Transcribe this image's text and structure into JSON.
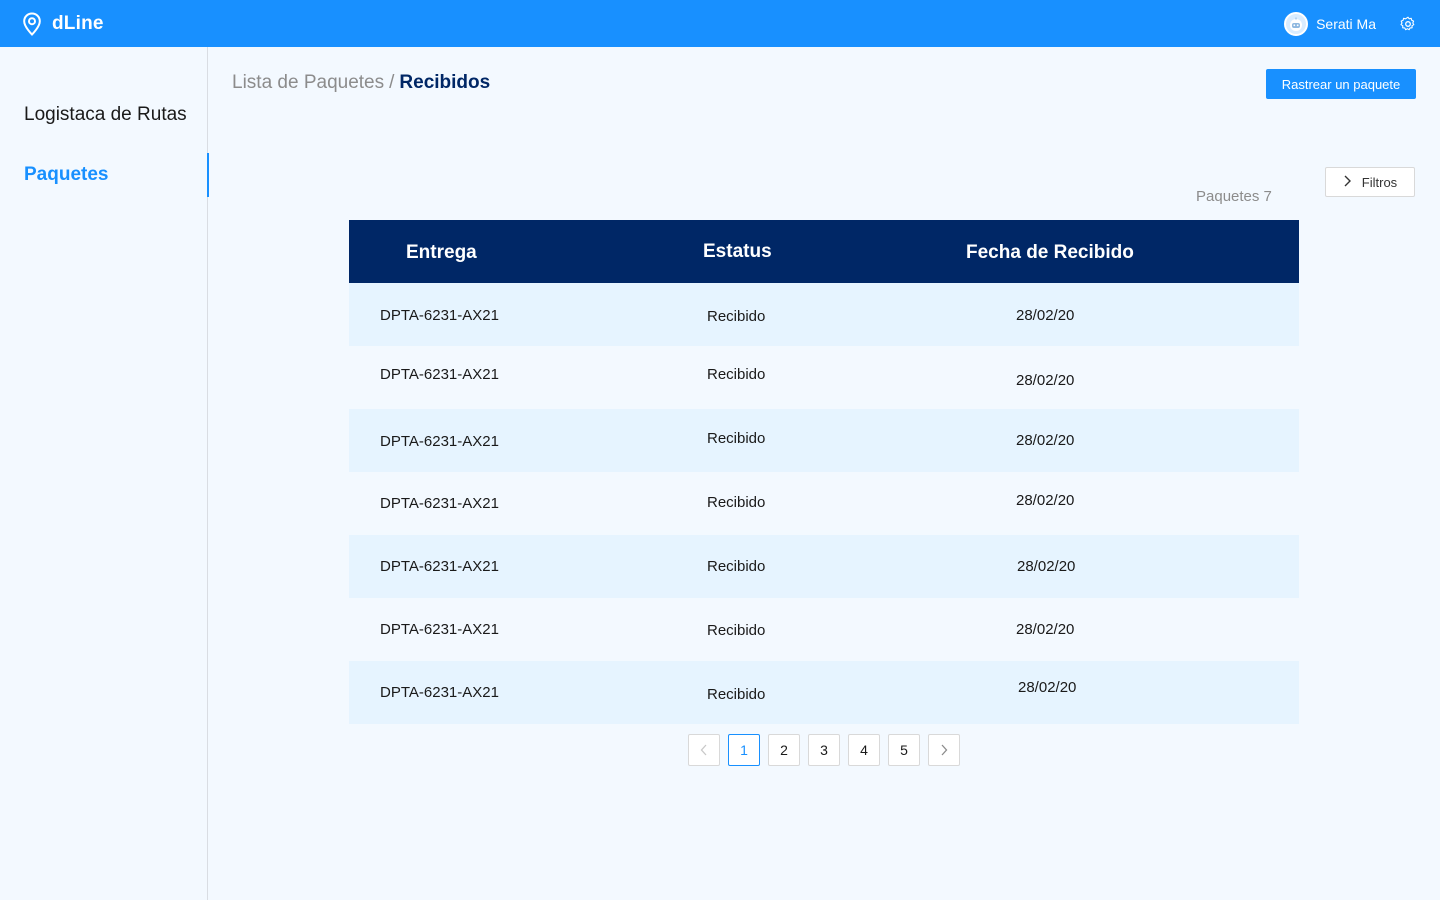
{
  "app": {
    "brand": "dLine",
    "user_name": "Serati Ma",
    "icons": {
      "brand": "location-pin-icon",
      "avatar": "robot-avatar-icon",
      "settings": "gear-icon"
    },
    "colors": {
      "primary": "#1890ff",
      "header_dark": "#002766",
      "row_highlight": "#e6f4ff"
    }
  },
  "sidebar": {
    "items": [
      {
        "label": "Logistaca de Rutas",
        "active": false
      },
      {
        "label": "Paquetes",
        "active": true
      }
    ]
  },
  "header": {
    "breadcrumb_parent": "Lista de Paquetes",
    "breadcrumb_separator": "/",
    "breadcrumb_current": "Recibidos",
    "track_button": "Rastrear un paquete",
    "filters_button": "Filtros",
    "count_label": "Paquetes 7"
  },
  "table": {
    "columns": [
      "Entrega",
      "Estatus",
      "Fecha de Recibido"
    ],
    "rows": [
      {
        "entrega": "DPTA-6231-AX21",
        "estatus": "Recibido",
        "fecha": "28/02/20"
      },
      {
        "entrega": "DPTA-6231-AX21",
        "estatus": "Recibido",
        "fecha": "28/02/20"
      },
      {
        "entrega": "DPTA-6231-AX21",
        "estatus": "Recibido",
        "fecha": "28/02/20"
      },
      {
        "entrega": "DPTA-6231-AX21",
        "estatus": "Recibido",
        "fecha": "28/02/20"
      },
      {
        "entrega": "DPTA-6231-AX21",
        "estatus": "Recibido",
        "fecha": "28/02/20"
      },
      {
        "entrega": "DPTA-6231-AX21",
        "estatus": "Recibido",
        "fecha": "28/02/20"
      },
      {
        "entrega": "DPTA-6231-AX21",
        "estatus": "Recibido",
        "fecha": "28/02/20"
      }
    ]
  },
  "pagination": {
    "prev": "<",
    "next": ">",
    "pages": [
      "1",
      "2",
      "3",
      "4",
      "5"
    ],
    "current": "1"
  }
}
